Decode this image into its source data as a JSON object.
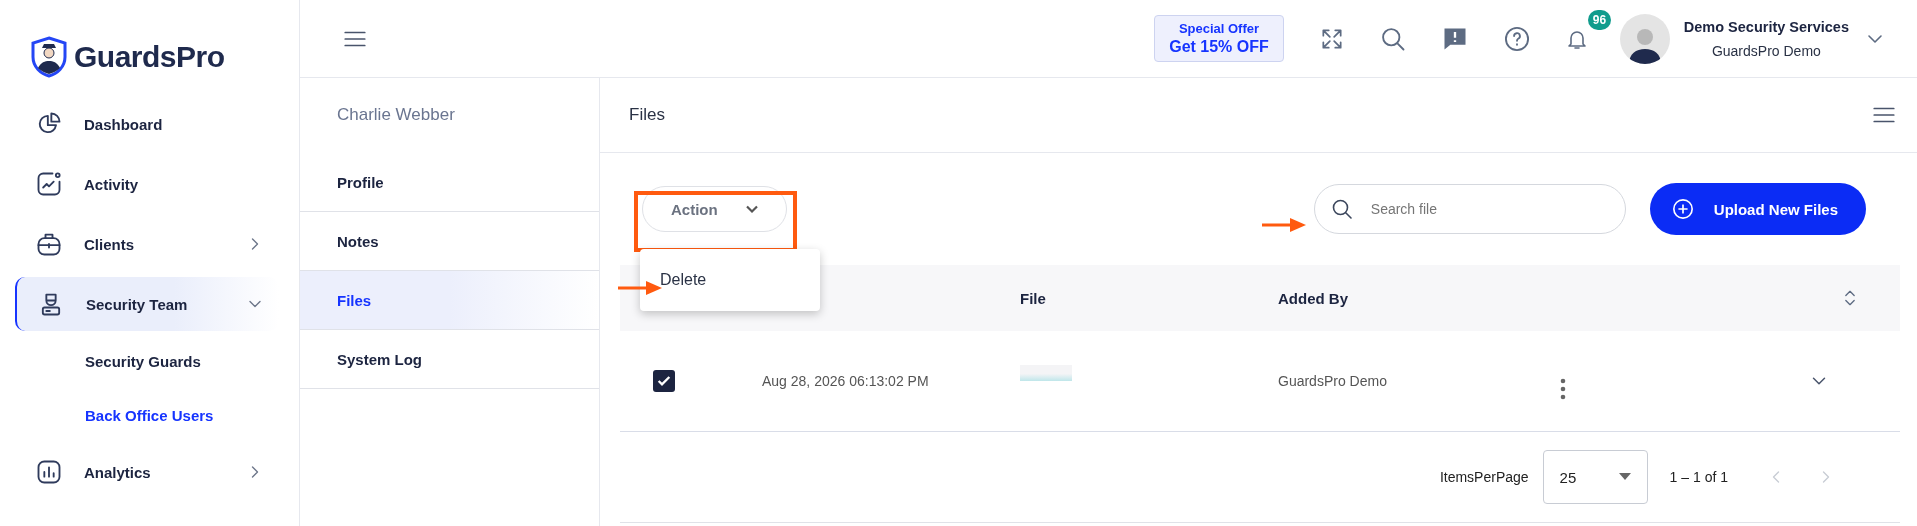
{
  "logo": "GuardsPro",
  "sidebar": {
    "items": [
      {
        "label": "Dashboard",
        "kind": "link",
        "selected": false
      },
      {
        "label": "Activity",
        "kind": "link",
        "selected": false
      },
      {
        "label": "Clients",
        "kind": "group",
        "expanded": false,
        "selected": false
      },
      {
        "label": "Security Team",
        "kind": "group",
        "expanded": true,
        "selected": true,
        "children": [
          {
            "label": "Security Guards",
            "selected": false
          },
          {
            "label": "Back Office Users",
            "selected": true
          }
        ]
      },
      {
        "label": "Analytics",
        "kind": "group",
        "expanded": false,
        "selected": false
      }
    ]
  },
  "topbar": {
    "offer": {
      "line_1": "Special Offer",
      "line_2": "Get 15% OFF"
    },
    "notification_count": "96",
    "user": {
      "name": "Demo Security Services",
      "company": "GuardsPro Demo"
    }
  },
  "profile_menu": {
    "title": "Charlie Webber",
    "tabs": [
      {
        "label": "Profile",
        "selected": false
      },
      {
        "label": "Notes",
        "selected": false
      },
      {
        "label": "Files",
        "selected": true
      },
      {
        "label": "System Log",
        "selected": false
      }
    ]
  },
  "files_panel": {
    "title": "Files",
    "action_button": "Action",
    "action_menu": [
      "Delete"
    ],
    "search": {
      "placeholder": "Search file"
    },
    "upload_button": "Upload New Files",
    "table": {
      "columns": [
        "File",
        "Added By"
      ],
      "rows": [
        {
          "checked": true,
          "date": "Aug 28, 2026 06:13:02 PM",
          "added_by": "GuardsPro Demo"
        }
      ]
    },
    "pagination": {
      "label": "ItemsPerPage",
      "page_size": "25",
      "range": "1 – 1 of 1"
    }
  }
}
